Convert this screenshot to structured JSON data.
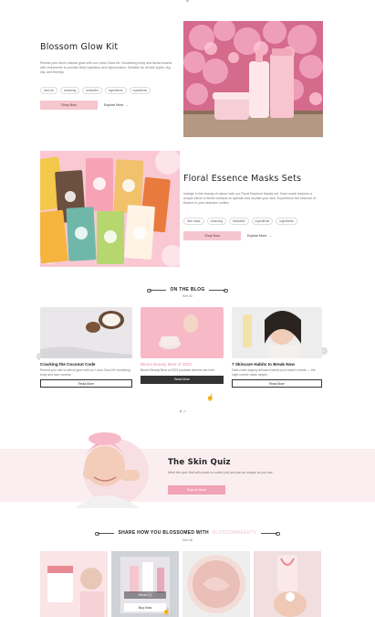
{
  "hero1": {
    "title": "Blossom Glow Kit",
    "desc": "Reveal your skin's natural glow with our Lotus Glow Kit. Nourishing body and facial creams with chamomile to provide deep hydration and rejuvenation. Suitable for all skin types: dry, oily, and friendly.",
    "tags": [
      "lotus kit",
      "cleansing",
      "bestseller",
      "ingredients",
      "ingredients"
    ],
    "primary_btn": "Shop Now",
    "secondary_btn": "Explore More"
  },
  "hero2": {
    "title": "Floral Essence Masks Sets",
    "desc": "Indulge in the beauty of nature with our Floral Essence Masks set. Each mask features a unique blend of flower extracts to hydrate and nourish your skin. Experience the essence of flowers in your skincare routine.",
    "tags": [
      "face mask",
      "cleansing",
      "bestseller",
      "ingredients",
      "ingredients"
    ],
    "primary_btn": "Shop Now",
    "secondary_btn": "Explore More"
  },
  "blog": {
    "heading": "ON THE BLOG",
    "sub": "See All",
    "cards": [
      {
        "title": "Cracking the Coconut Code",
        "desc": "Reveal your skin's natural glow with our Lotus Glow Kit nourishing body and face creams.",
        "btn": "Read More",
        "highlight": false
      },
      {
        "title": "Bloom Beauty Best of 2023",
        "desc": "Bloom Beauty Best of 2023 products winners are here",
        "btn": "Read More",
        "highlight": true
      },
      {
        "title": "7 Skincare Habits to Break Now",
        "desc": "Dark-circle-slaying skincare habits you'd want to break — the night routine made simple.",
        "btn": "Read More",
        "highlight": false
      }
    ]
  },
  "quiz": {
    "title": "The Skin Quiz",
    "desc": "Meet the quiz that will curate a routine just just just as unique as you are.",
    "btn": "Explore More"
  },
  "share": {
    "heading_prefix": "SHARE HOW YOU BLOSSOMED WITH",
    "heading_brand": "BLOSSOMBEAUTY",
    "sub": "See All",
    "overlay_label": "Serum (1)",
    "overlay_btn": "Buy Now"
  },
  "colors": {
    "pink_btn": "#f6c6cf",
    "quiz_bg": "#fbeef0",
    "accent": "#e98ea0"
  }
}
